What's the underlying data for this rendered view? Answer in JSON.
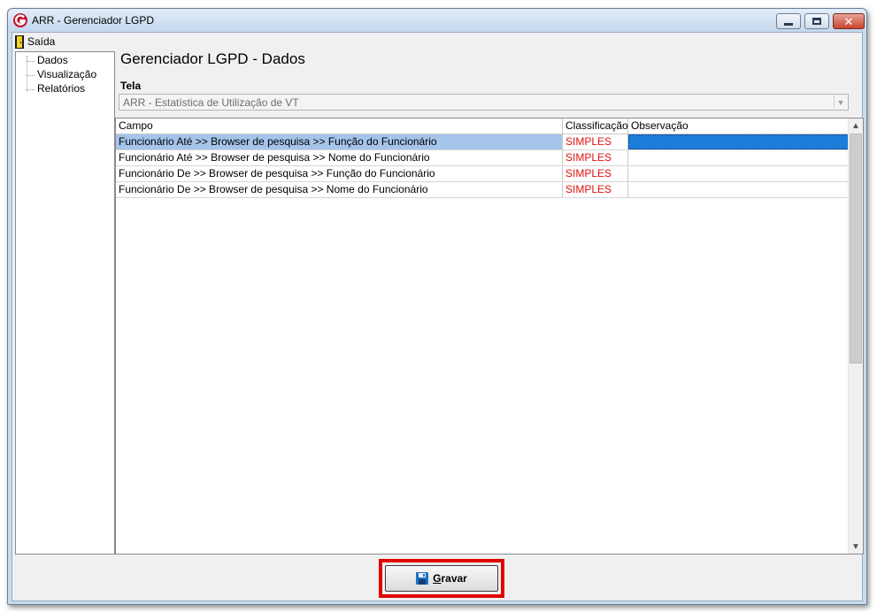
{
  "window": {
    "title": "ARR - Gerenciador LGPD"
  },
  "menu": {
    "exit_label": "Saída"
  },
  "tree": {
    "items": [
      {
        "label": "Dados"
      },
      {
        "label": "Visualização"
      },
      {
        "label": "Relatórios"
      }
    ]
  },
  "panel": {
    "title": "Gerenciador LGPD - Dados",
    "tela_label": "Tela",
    "tela_value": "ARR - Estatística de Utilização de VT"
  },
  "grid": {
    "columns": [
      "Campo",
      "Classificação",
      "Observação"
    ],
    "rows": [
      {
        "campo": "Funcionário Até >> Browser de pesquisa >> Função do Funcionário",
        "classificacao": "SIMPLES",
        "observacao": ""
      },
      {
        "campo": "Funcionário Até >> Browser de pesquisa >> Nome do Funcionário",
        "classificacao": "SIMPLES",
        "observacao": ""
      },
      {
        "campo": "Funcionário De >> Browser de pesquisa >> Função do Funcionário",
        "classificacao": "SIMPLES",
        "observacao": ""
      },
      {
        "campo": "Funcionário De >> Browser de pesquisa >> Nome do Funcionário",
        "classificacao": "SIMPLES",
        "observacao": ""
      }
    ]
  },
  "footer": {
    "save_label_first": "G",
    "save_label_rest": "ravar"
  },
  "colors": {
    "classification": "#e01010",
    "selected_row": "#a5c4ea",
    "selected_cell": "#1c7ddb",
    "highlight_border": "#e00000"
  },
  "icons": {
    "app": "app-logo-icon",
    "exit": "exit-door-icon",
    "save": "floppy-disk-icon"
  }
}
